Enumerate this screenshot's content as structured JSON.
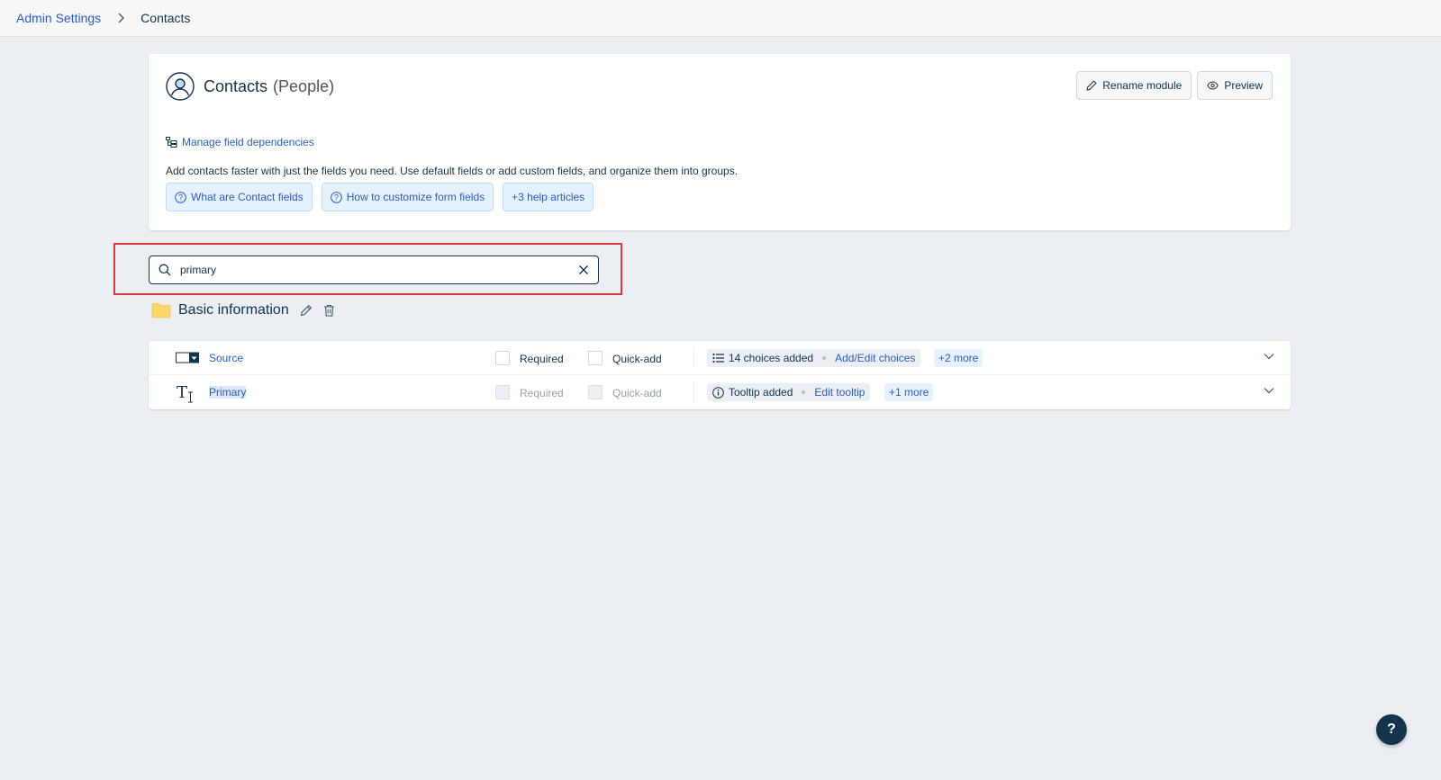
{
  "breadcrumb": {
    "parent": "Admin Settings",
    "current": "Contacts"
  },
  "module": {
    "title": "Contacts",
    "subtitle": "(People)",
    "description": "Add contacts faster with just the fields you need. Use default fields or add custom fields, and organize them into groups.",
    "dependencies_link": "Manage field dependencies",
    "rename_button": "Rename module",
    "preview_button": "Preview"
  },
  "help_links": [
    "What are Contact fields",
    "How to customize form fields",
    "+3 help articles"
  ],
  "search": {
    "value": "primary",
    "placeholder": ""
  },
  "group": {
    "title": "Basic information"
  },
  "fields": [
    {
      "name": "Source",
      "type_icon": "dropdown-field-icon",
      "required_label": "Required",
      "quickadd_label": "Quick-add",
      "disabled": false,
      "info_icon": "list-icon",
      "info_text": "14 choices added",
      "info_action": "Add/Edit choices",
      "more": "+2 more"
    },
    {
      "name": "Primary",
      "type_icon": "text-field-icon",
      "required_label": "Required",
      "quickadd_label": "Quick-add",
      "disabled": true,
      "info_icon": "info-icon",
      "info_text": "Tooltip added",
      "info_action": "Edit tooltip",
      "more": "+1 more"
    }
  ],
  "help_fab": "?",
  "colors": {
    "link": "#2c5cc5",
    "text": "#12344d",
    "highlight_border": "#e43538",
    "background": "#ebeef3"
  }
}
